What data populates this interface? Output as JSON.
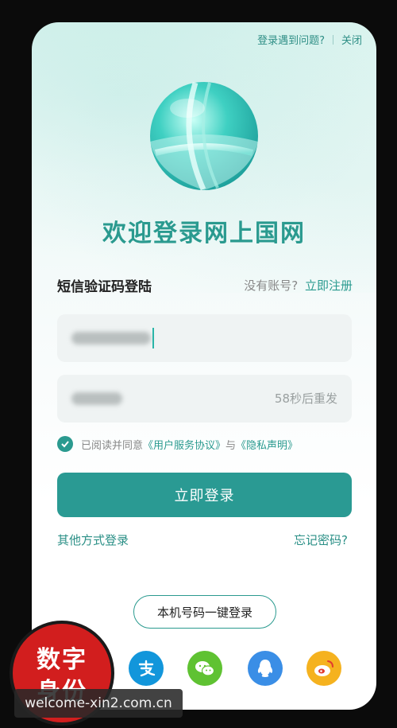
{
  "top_bar": {
    "help_link": "登录遇到问题?",
    "close_link": "关闭"
  },
  "title": "欢迎登录网上国网",
  "login_method": "短信验证码登陆",
  "register": {
    "prompt": "没有账号?",
    "link": "立即注册"
  },
  "code_field": {
    "countdown": "58秒后重发"
  },
  "agreement": {
    "prefix": "已阅读并同意",
    "terms": "《用户服务协议》",
    "and": "与",
    "privacy": "《隐私声明》"
  },
  "login_button": "立即登录",
  "other_login": "其他方式登录",
  "forgot_password": "忘记密码?",
  "one_key_login": "本机号码一键登录",
  "social_icons": [
    "alipay-icon",
    "wechat-icon",
    "qq-icon",
    "weibo-icon"
  ],
  "colors": {
    "accent": "#2a9a8f",
    "button": "#2a9a93",
    "alipay": "#1296db",
    "wechat": "#5fc232",
    "qq": "#3a8ee6",
    "weibo": "#f5b21f",
    "badge": "#d21e1e"
  },
  "overlay": {
    "badge_line1": "数字",
    "badge_line2": "身份",
    "watermark": "welcome-xin2.com.cn"
  }
}
